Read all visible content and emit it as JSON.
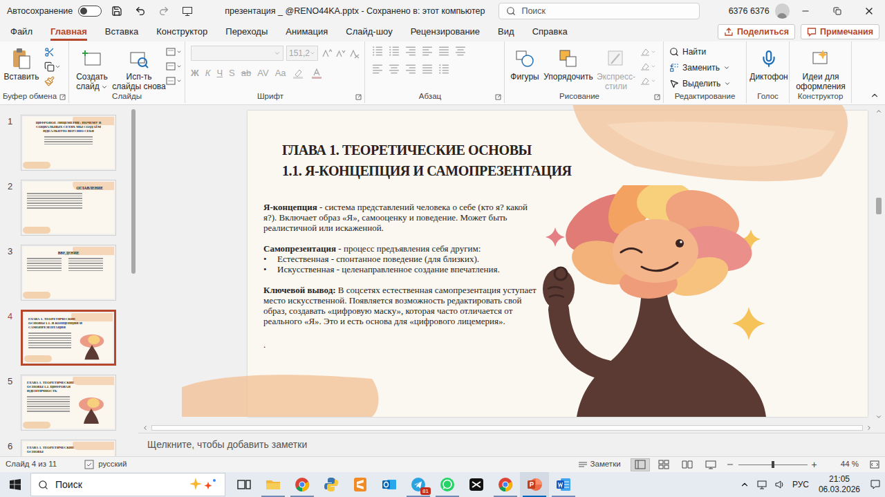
{
  "window": {
    "autosave_label": "Автосохранение",
    "autosave_on": false,
    "title": "презентация _ @RENO44KA.pptx - Сохранено в: этот компьютер",
    "search": "Поиск",
    "user": "6376 6376"
  },
  "menu": {
    "tabs": [
      {
        "label": "Файл",
        "selected": false
      },
      {
        "label": "Главная",
        "selected": true
      },
      {
        "label": "Вставка",
        "selected": false
      },
      {
        "label": "Конструктор",
        "selected": false
      },
      {
        "label": "Переходы",
        "selected": false
      },
      {
        "label": "Анимация",
        "selected": false
      },
      {
        "label": "Слайд-шоу",
        "selected": false
      },
      {
        "label": "Рецензирование",
        "selected": false
      },
      {
        "label": "Вид",
        "selected": false
      },
      {
        "label": "Справка",
        "selected": false
      }
    ],
    "share": "Поделиться",
    "comments": "Примечания"
  },
  "ribbon": {
    "clipboard": {
      "label": "Буфер обмена",
      "paste": "Вставить"
    },
    "slides": {
      "label": "Слайды",
      "new_slide": "Создать слайд",
      "reuse": "Исп-ть слайды снова"
    },
    "font": {
      "label": "Шрифт",
      "size": "151,2",
      "disabled": true,
      "buttons": [
        "Ж",
        "К",
        "Ч",
        "S",
        "ab",
        "AV",
        "Aa"
      ]
    },
    "paragraph": {
      "label": "Абзац",
      "disabled": true
    },
    "drawing": {
      "label": "Рисование",
      "items": [
        {
          "label": "Фигуры",
          "disabled": false
        },
        {
          "label": "Упорядочить",
          "disabled": false
        },
        {
          "label": "Экспресс-стили",
          "disabled": true
        }
      ]
    },
    "editing": {
      "label": "Редактирование",
      "items": [
        {
          "label": "Найти",
          "dropdown": false
        },
        {
          "label": "Заменить",
          "dropdown": true
        },
        {
          "label": "Выделить",
          "dropdown": true
        }
      ]
    },
    "voice": {
      "label": "Голос",
      "dictate": "Диктофон"
    },
    "designer": {
      "label": "Конструктор",
      "ideas": "Идеи для оформления"
    }
  },
  "thumbnails": [
    {
      "number": "1",
      "title": "ЦИФРОВОЕ ЛИЦЕМЕРИЕ: ПОЧЕМУ В СОЦИАЛЬНЫХ СЕТЯХ МЫ СОЗДАЁМ ИДЕАЛЬНУЮ ВЕРСИЮ СЕБЯ",
      "kind": "cover",
      "selected": false
    },
    {
      "number": "2",
      "title": "ОГЛАВЛЕНИЕ",
      "kind": "toc",
      "selected": false
    },
    {
      "number": "3",
      "title": "ВВЕДЕНИЕ",
      "kind": "intro",
      "selected": false
    },
    {
      "number": "4",
      "title": "ГЛАВА 1. ТЕОРЕТИЧЕСКИЕ ОСНОВЫ 1.1. Я-КОНЦЕПЦИЯ И САМОПРЕЗЕНТАЦИЯ",
      "kind": "chapter",
      "selected": true
    },
    {
      "number": "5",
      "title": "ГЛАВА 1. ТЕОРЕТИЧЕСКИЕ ОСНОВЫ 1.2. ЦИФРОВАЯ ИДЕНТИЧНОСТЬ",
      "kind": "chapter",
      "selected": false
    },
    {
      "number": "6",
      "title": "ГЛАВА 1. ТЕОРЕТИЧЕСКИЕ ОСНОВЫ",
      "kind": "chapter",
      "selected": false
    }
  ],
  "slide": {
    "title_lines": [
      "ГЛАВА 1. ТЕОРЕТИЧЕСКИЕ ОСНОВЫ",
      "1.1. Я-КОНЦЕПЦИЯ И САМОПРЕЗЕНТАЦИЯ"
    ],
    "paragraphs": [
      {
        "term": "Я-концепция",
        "text": "- система представлений человека о себе (кто я? какой я?). Включает образ «Я», самооценку и поведение. Может быть реалистичной или искаженной.",
        "bullets": []
      },
      {
        "term": "Самопрезентация",
        "text": "- процесс предъявления себя другим:",
        "bullets": [
          "Естественная - спонтанное поведение (для близких).",
          "Искусственная - целенаправленное создание впечатления."
        ]
      },
      {
        "term": "Ключевой вывод:",
        "text": "В соцсетях естественная самопрезентация уступает место искусственной. Появляется возможность редактировать свой образ, создавать «цифровую маску», которая часто отличается от реального «Я». Это и есть основа для «цифрового лицемерия».",
        "bullets": []
      }
    ],
    "bullet": "•",
    "trailing": "."
  },
  "notes": {
    "placeholder": "Щелкните, чтобы добавить заметки"
  },
  "status_bar": {
    "slide": "Слайд 4 из 11",
    "language": "русский",
    "notes": "Заметки",
    "views": [
      {
        "kind": "normal",
        "selected": true
      },
      {
        "kind": "sorter",
        "selected": false
      },
      {
        "kind": "reading",
        "selected": false
      },
      {
        "kind": "slideshow",
        "selected": false
      }
    ],
    "zoom": "44 %",
    "zoom_level": 0.5
  },
  "taskbar": {
    "search": "Поиск",
    "apps": [
      {
        "kind": "taskview",
        "running": false,
        "active": false
      },
      {
        "kind": "explorer",
        "running": true,
        "active": false
      },
      {
        "kind": "chrome",
        "running": true,
        "active": false
      },
      {
        "kind": "python",
        "running": false,
        "active": false
      },
      {
        "kind": "sublime",
        "running": false,
        "active": false
      },
      {
        "kind": "outlook",
        "running": false,
        "active": false
      },
      {
        "kind": "telegram",
        "running": true,
        "active": false,
        "badge": "81"
      },
      {
        "kind": "whatsapp",
        "running": true,
        "active": false
      },
      {
        "kind": "capcut",
        "running": false,
        "active": false
      },
      {
        "kind": "chrome",
        "running": true,
        "active": false
      },
      {
        "kind": "powerpoint",
        "running": true,
        "active": true
      },
      {
        "kind": "word",
        "running": true,
        "active": false
      }
    ],
    "language": "РУС",
    "time": "21:05",
    "date": "06.03.2026"
  }
}
